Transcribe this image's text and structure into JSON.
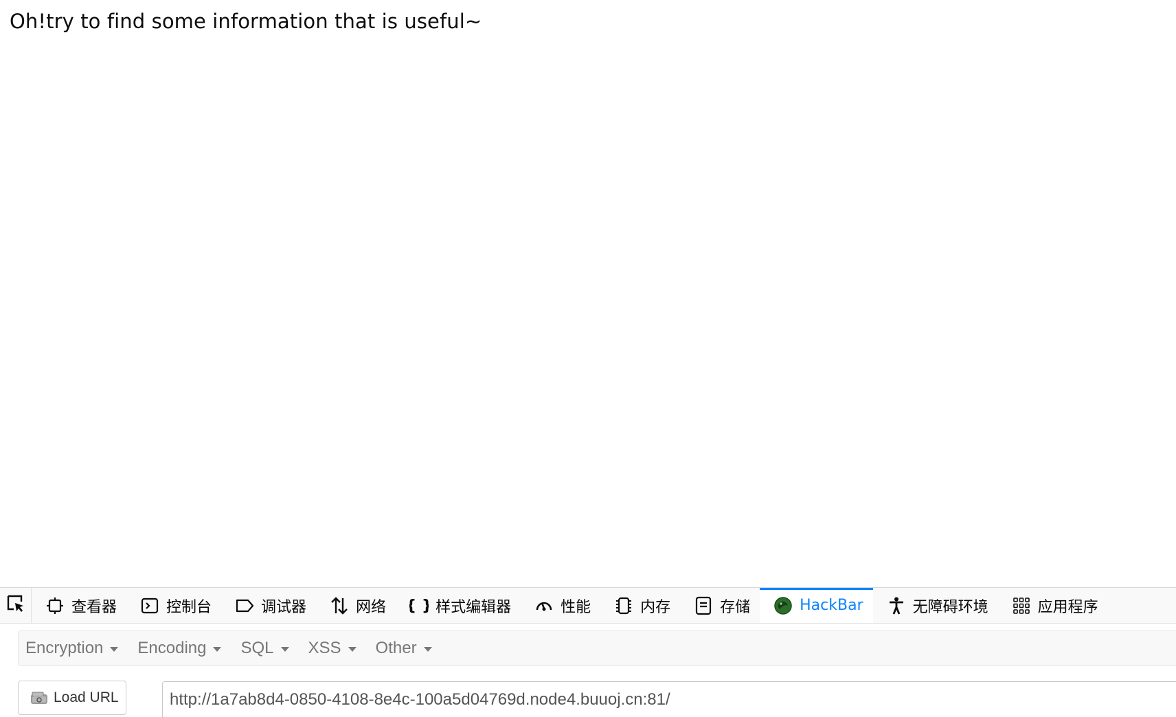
{
  "page": {
    "message": "Oh!try to find some information that is useful~"
  },
  "devtools": {
    "tabs": [
      {
        "label": "查看器",
        "icon": "inspector-icon"
      },
      {
        "label": "控制台",
        "icon": "console-icon"
      },
      {
        "label": "调试器",
        "icon": "debugger-icon"
      },
      {
        "label": "网络",
        "icon": "network-icon"
      },
      {
        "label": "样式编辑器",
        "icon": "style-editor-icon"
      },
      {
        "label": "性能",
        "icon": "performance-icon"
      },
      {
        "label": "内存",
        "icon": "memory-icon"
      },
      {
        "label": "存储",
        "icon": "storage-icon"
      },
      {
        "label": "HackBar",
        "icon": "hackbar-icon",
        "active": true
      },
      {
        "label": "无障碍环境",
        "icon": "accessibility-icon"
      },
      {
        "label": "应用程序",
        "icon": "application-icon"
      }
    ],
    "active_color": "#0a84ff"
  },
  "hackbar": {
    "menu": [
      "Encryption",
      "Encoding",
      "SQL",
      "XSS",
      "Other"
    ],
    "load_url_label": "Load URL",
    "url_value": "http://1a7ab8d4-0850-4108-8e4c-100a5d04769d.node4.buuoj.cn:81/"
  }
}
